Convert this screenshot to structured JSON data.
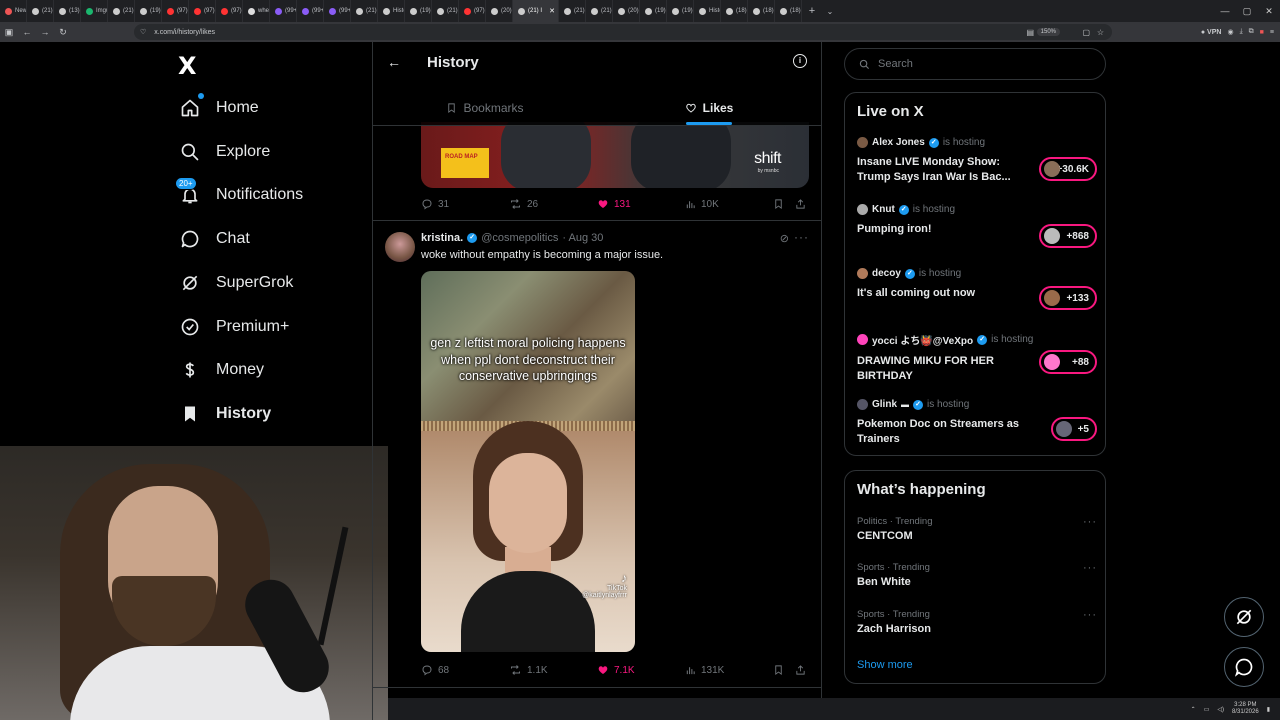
{
  "browser": {
    "tabs": [
      {
        "label": "New",
        "color": "#e55"
      },
      {
        "label": "(21) I",
        "color": "#ccc"
      },
      {
        "label": "(13) w",
        "color": "#ccc"
      },
      {
        "label": "Imgur",
        "color": "#1bb76e"
      },
      {
        "label": "(21) I",
        "color": "#ccc"
      },
      {
        "label": "(19) I",
        "color": "#ccc"
      },
      {
        "label": "(97) I",
        "color": "#f33"
      },
      {
        "label": "(97) b",
        "color": "#f33"
      },
      {
        "label": "(97) I",
        "color": "#f33"
      },
      {
        "label": "wher",
        "color": "#ddd"
      },
      {
        "label": "(99+)",
        "color": "#8a5cf6"
      },
      {
        "label": "(99+)",
        "color": "#8a5cf6"
      },
      {
        "label": "(99+)",
        "color": "#8a5cf6"
      },
      {
        "label": "(21) s",
        "color": "#ccc"
      },
      {
        "label": "Histo",
        "color": "#ccc"
      },
      {
        "label": "(19) I",
        "color": "#ccc"
      },
      {
        "label": "(21) I",
        "color": "#ccc"
      },
      {
        "label": "(97) Y",
        "color": "#f33"
      },
      {
        "label": "(20) I",
        "color": "#ccc"
      },
      {
        "label": "(21) I",
        "color": "#ccc",
        "active": true
      },
      {
        "label": "(21) T",
        "color": "#ccc"
      },
      {
        "label": "(21) I",
        "color": "#ccc"
      },
      {
        "label": "(20) I",
        "color": "#ccc"
      },
      {
        "label": "(19) I",
        "color": "#ccc"
      },
      {
        "label": "(19) I",
        "color": "#ccc"
      },
      {
        "label": "Histo",
        "color": "#ccc"
      },
      {
        "label": "(18) I",
        "color": "#ccc"
      },
      {
        "label": "(18) S",
        "color": "#ccc"
      },
      {
        "label": "(18) I",
        "color": "#ccc"
      }
    ],
    "url": "x.com/i/history/likes",
    "zoom": "150%",
    "vpn_label": "VPN"
  },
  "nav": {
    "logo": "X",
    "items": [
      {
        "label": "Home",
        "icon": "home-icon"
      },
      {
        "label": "Explore",
        "icon": "search-icon"
      },
      {
        "label": "Notifications",
        "icon": "bell-icon",
        "badge": "20+"
      },
      {
        "label": "Chat",
        "icon": "chat-icon"
      },
      {
        "label": "SuperGrok",
        "icon": "grok-icon"
      },
      {
        "label": "Premium+",
        "icon": "verified-icon"
      },
      {
        "label": "Money",
        "icon": "dollar-icon"
      },
      {
        "label": "History",
        "icon": "bookmark-icon",
        "active": true
      }
    ]
  },
  "main": {
    "title": "History",
    "tabs": [
      {
        "label": "Bookmarks",
        "icon": "bookmark-icon"
      },
      {
        "label": "Likes",
        "icon": "heart-icon",
        "active": true
      }
    ],
    "top_post": {
      "media_text_roadmap": "ROAD MAP",
      "media_text_brand": "shift",
      "media_text_sub": "by msnbc",
      "replies": "31",
      "reposts": "26",
      "likes": "131",
      "views": "10K"
    },
    "post": {
      "author": "kristina.",
      "handle": "@cosmepolitics",
      "date": "· Aug 30",
      "text": "woke without empathy is becoming a major issue.",
      "video_caption": "gen z leftist moral policing happens when ppl dont deconstruct their conservative upbringings",
      "tiktok_label": "TikTok",
      "tiktok_handle": "@kaitlynlayfrrr",
      "replies": "68",
      "reposts": "1.1K",
      "likes": "7.1K",
      "views": "131K"
    }
  },
  "sidebar": {
    "search_placeholder": "Search",
    "live_title": "Live on X",
    "hosting_label": "is hosting",
    "live": [
      {
        "host": "Alex Jones",
        "title": "Insane LIVE Monday Show: Trump Says Iran War Is Bac...",
        "count": "+30.6K"
      },
      {
        "host": "Knut",
        "title": "Pumping iron!",
        "count": "+868"
      },
      {
        "host": "decoy",
        "title": "It's all coming out now",
        "count": "+133"
      },
      {
        "host": "yocci よち👹@VeXpo",
        "title": "DRAWING MIKU FOR HER BIRTHDAY",
        "count": "+88"
      },
      {
        "host": "Glink",
        "title": "Pokemon Doc on Streamers as Trainers",
        "count": "+5"
      }
    ],
    "happening_title": "What’s happening",
    "trends": [
      {
        "context": "Politics · Trending",
        "name": "CENTCOM"
      },
      {
        "context": "Sports · Trending",
        "name": "Ben White"
      },
      {
        "context": "Sports · Trending",
        "name": "Zach Harrison"
      }
    ],
    "show_more": "Show more"
  },
  "taskbar": {
    "time": "3:28 PM",
    "date": "8/31/2026"
  },
  "colors": {
    "accent": "#1d9bf0",
    "like": "#f91880",
    "background": "#000000",
    "border": "#2f3336"
  }
}
